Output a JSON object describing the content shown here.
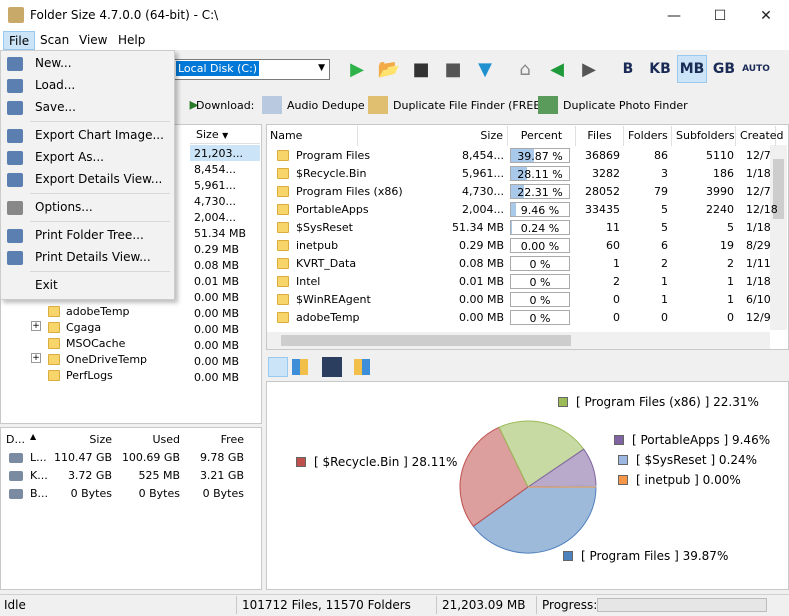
{
  "window": {
    "title": "Folder Size 4.7.0.0 (64-bit) - C:\\",
    "minimize": "—",
    "maximize": "☐",
    "close": "✕"
  },
  "menu": [
    "File",
    "Scan",
    "View",
    "Help"
  ],
  "file_menu": [
    {
      "label": "New...",
      "icon": "new-file-icon"
    },
    {
      "label": "Load...",
      "icon": "load-icon"
    },
    {
      "label": "Save...",
      "icon": "save-icon"
    },
    {
      "label": "Export Chart Image...",
      "icon": "chart-export-icon"
    },
    {
      "label": "Export As...",
      "icon": "export-as-icon"
    },
    {
      "label": "Export Details View...",
      "icon": "export-details-icon"
    },
    {
      "label": "Options...",
      "icon": "gear-icon"
    },
    {
      "label": "Print Folder Tree...",
      "icon": "printer-icon"
    },
    {
      "label": "Print Details View...",
      "icon": "printer-icon"
    },
    {
      "label": "Exit",
      "icon": ""
    }
  ],
  "toolbar": {
    "drive": "Local Disk (C:)",
    "units": [
      "B",
      "KB",
      "MB",
      "GB",
      "AUTO"
    ],
    "active_unit": "MB"
  },
  "downloads": {
    "label": "Download:",
    "items": [
      "Audio Dedupe",
      "Duplicate File Finder (FREE)",
      "Duplicate Photo Finder"
    ]
  },
  "tree": {
    "size_header": "Size",
    "sizes": [
      "21,203...",
      "8,454...",
      "5,961...",
      "4,730...",
      "2,004...",
      "51.34 MB",
      "0.29 MB",
      "0.08 MB",
      "0.01 MB",
      "0.00 MB",
      "0.00 MB",
      "0.00 MB",
      "0.00 MB",
      "0.00 MB",
      "0.00 MB"
    ],
    "visible_items": [
      {
        "name": "adobeTemp",
        "size": "0.00 MB",
        "expand": ""
      },
      {
        "name": "Cgaga",
        "size": "0.00 MB",
        "expand": "+"
      },
      {
        "name": "MSOCache",
        "size": "0.00 MB",
        "expand": ""
      },
      {
        "name": "OneDriveTemp",
        "size": "0.00 MB",
        "expand": "+"
      },
      {
        "name": "PerfLogs",
        "size": "0.00 MB",
        "expand": ""
      }
    ]
  },
  "details": {
    "headers": [
      "Name",
      "Size",
      "Percent",
      "Files",
      "Folders",
      "Subfolders",
      "Created"
    ],
    "rows": [
      {
        "name": "Program Files",
        "size": "8,454...",
        "percent": "39.87 %",
        "pct": 39.87,
        "files": "36869",
        "folders": "86",
        "subfolders": "5110",
        "created": "12/7"
      },
      {
        "name": "$Recycle.Bin",
        "size": "5,961...",
        "percent": "28.11 %",
        "pct": 28.11,
        "files": "3282",
        "folders": "3",
        "subfolders": "186",
        "created": "1/18"
      },
      {
        "name": "Program Files (x86)",
        "size": "4,730...",
        "percent": "22.31 %",
        "pct": 22.31,
        "files": "28052",
        "folders": "79",
        "subfolders": "3990",
        "created": "12/7"
      },
      {
        "name": "PortableApps",
        "size": "2,004...",
        "percent": "9.46 %",
        "pct": 9.46,
        "files": "33435",
        "folders": "5",
        "subfolders": "2240",
        "created": "12/18"
      },
      {
        "name": "$SysReset",
        "size": "51.34 MB",
        "percent": "0.24 %",
        "pct": 0.24,
        "files": "11",
        "folders": "5",
        "subfolders": "5",
        "created": "1/18"
      },
      {
        "name": "inetpub",
        "size": "0.29 MB",
        "percent": "0.00 %",
        "pct": 0,
        "files": "60",
        "folders": "6",
        "subfolders": "19",
        "created": "8/29"
      },
      {
        "name": "KVRT_Data",
        "size": "0.08 MB",
        "percent": "0 %",
        "pct": 0,
        "files": "1",
        "folders": "2",
        "subfolders": "2",
        "created": "1/11"
      },
      {
        "name": "Intel",
        "size": "0.01 MB",
        "percent": "0 %",
        "pct": 0,
        "files": "2",
        "folders": "1",
        "subfolders": "1",
        "created": "1/18"
      },
      {
        "name": "$WinREAgent",
        "size": "0.00 MB",
        "percent": "0 %",
        "pct": 0,
        "files": "0",
        "folders": "1",
        "subfolders": "1",
        "created": "6/10"
      },
      {
        "name": "adobeTemp",
        "size": "0.00 MB",
        "percent": "0 %",
        "pct": 0,
        "files": "0",
        "folders": "0",
        "subfolders": "0",
        "created": "12/9"
      }
    ]
  },
  "drives": {
    "headers": [
      "D...",
      "Size",
      "Used",
      "Free"
    ],
    "rows": [
      {
        "name": "L...",
        "size": "110.47 GB",
        "used": "100.69 GB",
        "free": "9.78 GB"
      },
      {
        "name": "K...",
        "size": "3.72 GB",
        "used": "525 MB",
        "free": "3.21 GB"
      },
      {
        "name": "B...",
        "size": "0 Bytes",
        "used": "0 Bytes",
        "free": "0 Bytes"
      }
    ]
  },
  "chart_data": {
    "type": "pie",
    "categories": [
      "Program Files",
      "$Recycle.Bin",
      "Program Files (x86)",
      "PortableApps",
      "$SysReset",
      "inetpub"
    ],
    "values": [
      39.87,
      28.11,
      22.31,
      9.46,
      0.24,
      0.0
    ],
    "labels": [
      "[ Program Files ] 39.87%",
      "[ $Recycle.Bin ] 28.11%",
      "[ Program Files (x86) ] 22.31%",
      "[ PortableApps ] 9.46%",
      "[ $SysReset ] 0.24%",
      "[ inetpub ] 0.00%"
    ],
    "colors": [
      "#4f81bd",
      "#c0504d",
      "#9bbb59",
      "#8064a2",
      "#9cb8e0",
      "#f79646"
    ]
  },
  "status": {
    "state": "Idle",
    "files": "101712 Files, 11570 Folders",
    "size": "21,203.09 MB",
    "progress_label": "Progress:"
  }
}
